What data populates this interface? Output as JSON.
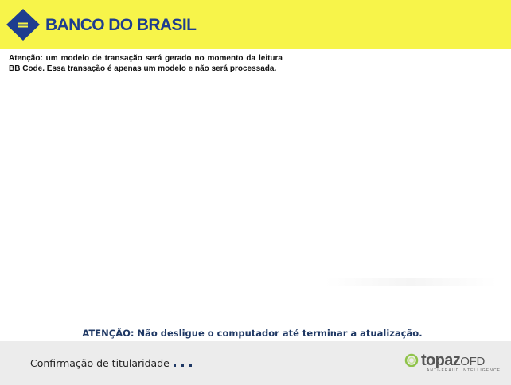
{
  "header": {
    "logo_text": "BANCO DO BRASIL",
    "background_color": "#f7f44a",
    "brand_color": "#1e3d8f"
  },
  "notice": {
    "text": "Atenção: um modelo de transação será gerado no momento da leitura BB Code. Essa transação é apenas um modelo e não será processada."
  },
  "warning": {
    "text": "ATENÇÃO: Não desligue o computador até terminar a atualização."
  },
  "footer": {
    "status_text": "Confirmação de titularidade",
    "loading_indicator": "three-dots",
    "brand": {
      "name_bold": "topaz",
      "name_suffix": "OFD",
      "tagline": "ANTI-FRAUD INTELLIGENCE",
      "icon": "topaz-ring-icon"
    }
  }
}
